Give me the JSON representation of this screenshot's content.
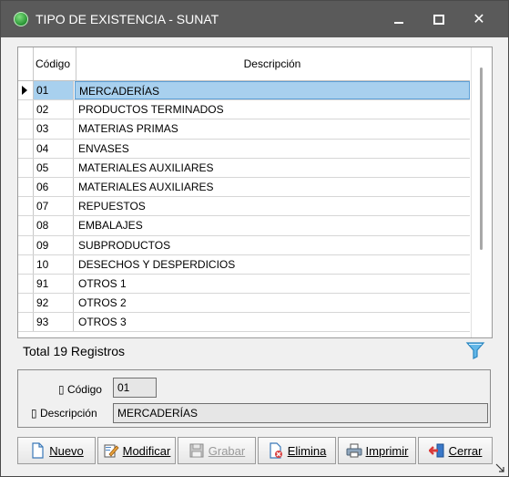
{
  "window": {
    "title": "TIPO DE EXISTENCIA - SUNAT",
    "accent_color": "#5a5a5a",
    "icon": "app-green-globe-icon"
  },
  "grid": {
    "columns": [
      "Código",
      "Descripción"
    ],
    "rows": [
      {
        "code": "01",
        "desc": "MERCADERÍAS"
      },
      {
        "code": "02",
        "desc": "PRODUCTOS TERMINADOS"
      },
      {
        "code": "03",
        "desc": "MATERIAS PRIMAS"
      },
      {
        "code": "04",
        "desc": "ENVASES"
      },
      {
        "code": "05",
        "desc": "MATERIALES AUXILIARES"
      },
      {
        "code": "06",
        "desc": "MATERIALES AUXILIARES"
      },
      {
        "code": "07",
        "desc": "REPUESTOS"
      },
      {
        "code": "08",
        "desc": "EMBALAJES"
      },
      {
        "code": "09",
        "desc": "SUBPRODUCTOS"
      },
      {
        "code": "10",
        "desc": "DESECHOS Y DESPERDICIOS"
      },
      {
        "code": "91",
        "desc": "OTROS 1"
      },
      {
        "code": "92",
        "desc": "OTROS 2"
      },
      {
        "code": "93",
        "desc": "OTROS 3"
      }
    ],
    "selected_index": 0,
    "selection_color": "#a8d0ee"
  },
  "footer": {
    "total_label": "Total 19 Registros",
    "filter_icon": "filter-funnel-icon"
  },
  "form": {
    "code_label": "Código",
    "code_value": "01",
    "desc_label": "Descripción",
    "desc_value": "MERCADERÍAS"
  },
  "buttons": {
    "nuevo": "Nuevo",
    "modificar": "Modificar",
    "grabar": "Grabar",
    "elimina": "Elimina",
    "imprimir": "Imprimir",
    "cerrar": "Cerrar"
  }
}
